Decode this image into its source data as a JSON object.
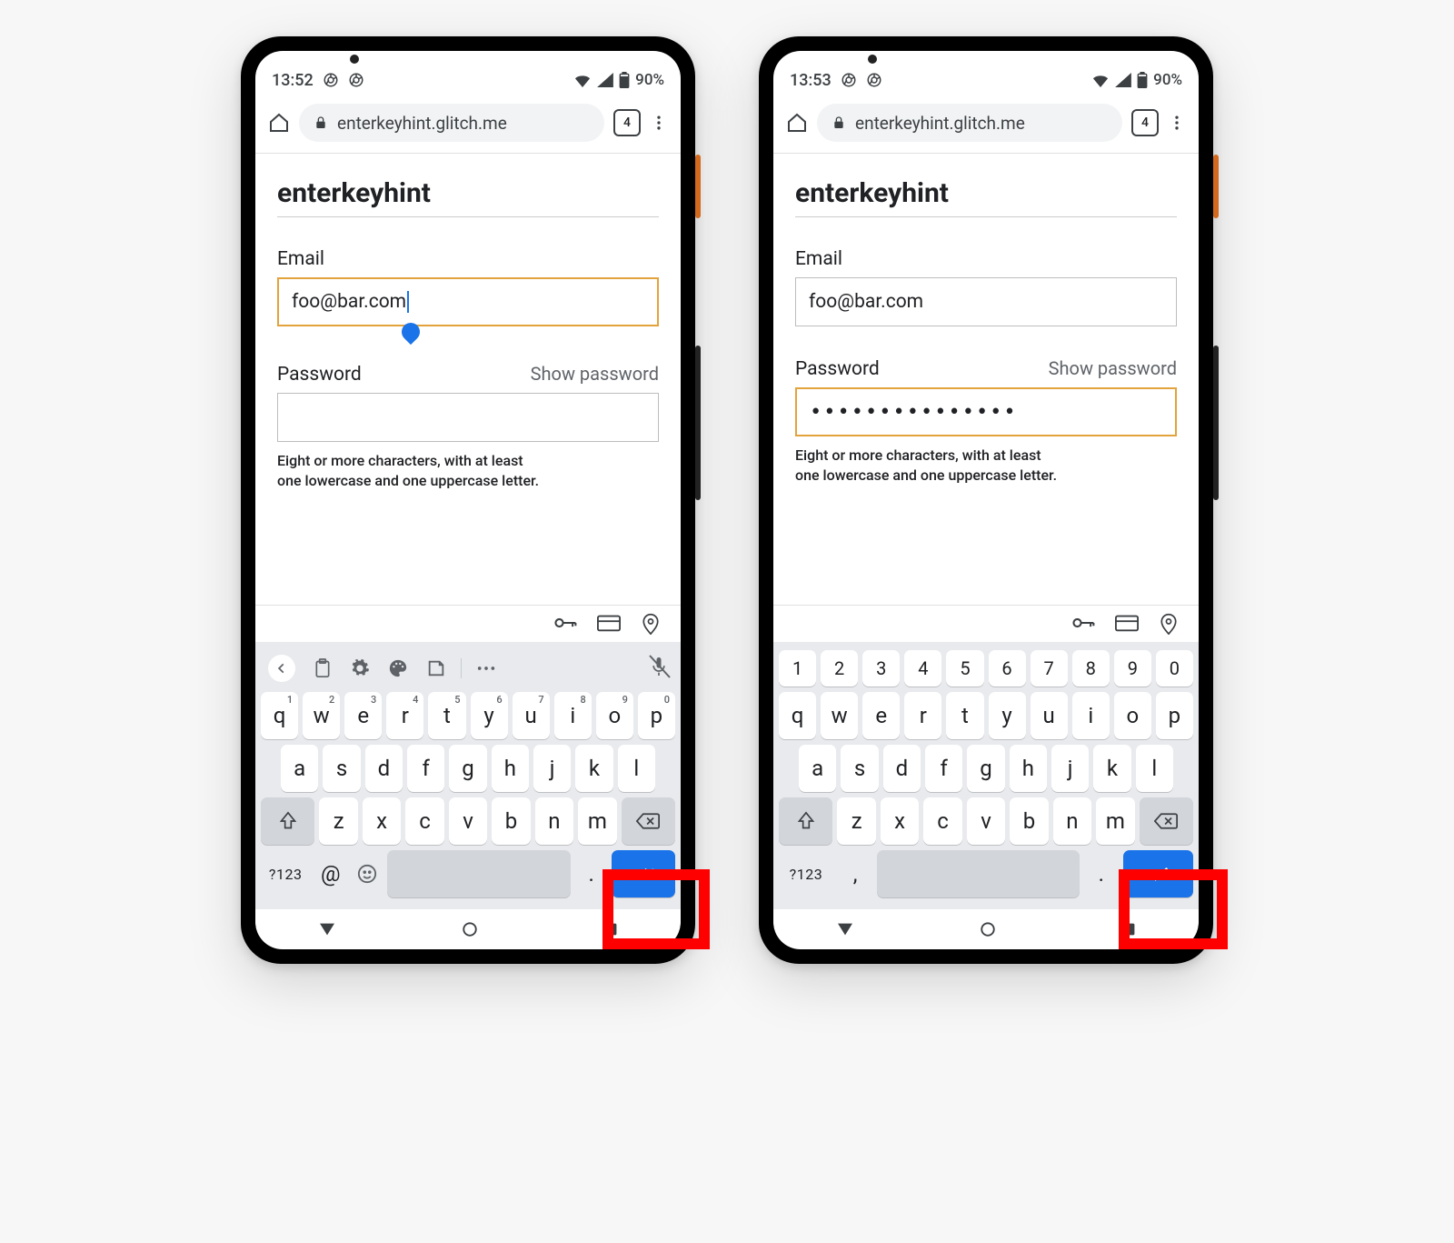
{
  "phone_left": {
    "status": {
      "time": "13:52",
      "battery_pct": "90%"
    },
    "chrome": {
      "url": "enterkeyhint.glitch.me",
      "tab_count": "4"
    },
    "page": {
      "title": "enterkeyhint",
      "email_label": "Email",
      "email_value": "foo@bar.com",
      "email_focused": true,
      "password_label": "Password",
      "password_value": "",
      "password_focused": false,
      "show_password": "Show password",
      "hint_line1": "Eight or more characters, with at least",
      "hint_line2": "one lowercase and one uppercase letter."
    },
    "keyboard": {
      "mode": "email",
      "sym_label": "?123",
      "at_label": "@",
      "dot_label": ".",
      "enter_action": "next",
      "row1": [
        {
          "k": "q",
          "s": "1"
        },
        {
          "k": "w",
          "s": "2"
        },
        {
          "k": "e",
          "s": "3"
        },
        {
          "k": "r",
          "s": "4"
        },
        {
          "k": "t",
          "s": "5"
        },
        {
          "k": "y",
          "s": "6"
        },
        {
          "k": "u",
          "s": "7"
        },
        {
          "k": "i",
          "s": "8"
        },
        {
          "k": "o",
          "s": "9"
        },
        {
          "k": "p",
          "s": "0"
        }
      ],
      "row2": [
        "a",
        "s",
        "d",
        "f",
        "g",
        "h",
        "j",
        "k",
        "l"
      ],
      "row3": [
        "z",
        "x",
        "c",
        "v",
        "b",
        "n",
        "m"
      ]
    }
  },
  "phone_right": {
    "status": {
      "time": "13:53",
      "battery_pct": "90%"
    },
    "chrome": {
      "url": "enterkeyhint.glitch.me",
      "tab_count": "4"
    },
    "page": {
      "title": "enterkeyhint",
      "email_label": "Email",
      "email_value": "foo@bar.com",
      "email_focused": false,
      "password_label": "Password",
      "password_value": "•••••••••••••••",
      "password_focused": true,
      "show_password": "Show password",
      "hint_line1": "Eight or more characters, with at least",
      "hint_line2": "one lowercase and one uppercase letter."
    },
    "keyboard": {
      "mode": "password",
      "sym_label": "?123",
      "comma_label": ",",
      "dot_label": ".",
      "enter_action": "done",
      "row0": [
        "1",
        "2",
        "3",
        "4",
        "5",
        "6",
        "7",
        "8",
        "9",
        "0"
      ],
      "row1": [
        {
          "k": "q"
        },
        {
          "k": "w"
        },
        {
          "k": "e"
        },
        {
          "k": "r"
        },
        {
          "k": "t"
        },
        {
          "k": "y"
        },
        {
          "k": "u"
        },
        {
          "k": "i"
        },
        {
          "k": "o"
        },
        {
          "k": "p"
        }
      ],
      "row2": [
        "a",
        "s",
        "d",
        "f",
        "g",
        "h",
        "j",
        "k",
        "l"
      ],
      "row3": [
        "z",
        "x",
        "c",
        "v",
        "b",
        "n",
        "m"
      ]
    }
  }
}
